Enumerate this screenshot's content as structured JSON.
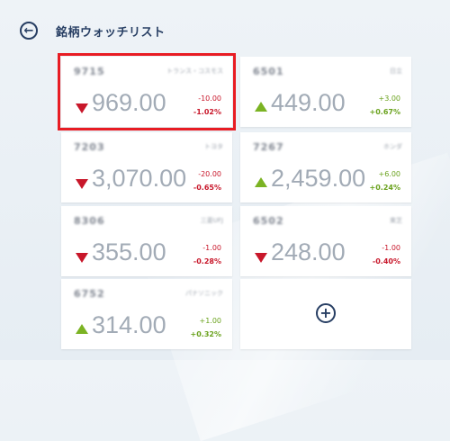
{
  "header": {
    "title": "銘柄ウォッチリスト",
    "back_icon": "back-arrow-icon"
  },
  "colors": {
    "negative": "#c8172a",
    "positive": "#6aa21d",
    "selection": "#e81c23",
    "accent": "#273e63"
  },
  "stocks": [
    {
      "code": "9715",
      "name": "トランス・コスモス",
      "price": "969.00",
      "change": "-10.00",
      "percent": "-1.02%",
      "direction": "down"
    },
    {
      "code": "6501",
      "name": "日立",
      "price": "449.00",
      "change": "+3.00",
      "percent": "+0.67%",
      "direction": "up"
    },
    {
      "code": "7203",
      "name": "トヨタ",
      "price": "3,070.00",
      "change": "-20.00",
      "percent": "-0.65%",
      "direction": "down"
    },
    {
      "code": "7267",
      "name": "ホンダ",
      "price": "2,459.00",
      "change": "+6.00",
      "percent": "+0.24%",
      "direction": "up"
    },
    {
      "code": "8306",
      "name": "三菱UFJ",
      "price": "355.00",
      "change": "-1.00",
      "percent": "-0.28%",
      "direction": "down"
    },
    {
      "code": "6502",
      "name": "東芝",
      "price": "248.00",
      "change": "-1.00",
      "percent": "-0.40%",
      "direction": "down"
    },
    {
      "code": "6752",
      "name": "パナソニック",
      "price": "314.00",
      "change": "+1.00",
      "percent": "+0.32%",
      "direction": "up"
    }
  ],
  "add_tile": {
    "icon": "plus-circle-icon"
  }
}
